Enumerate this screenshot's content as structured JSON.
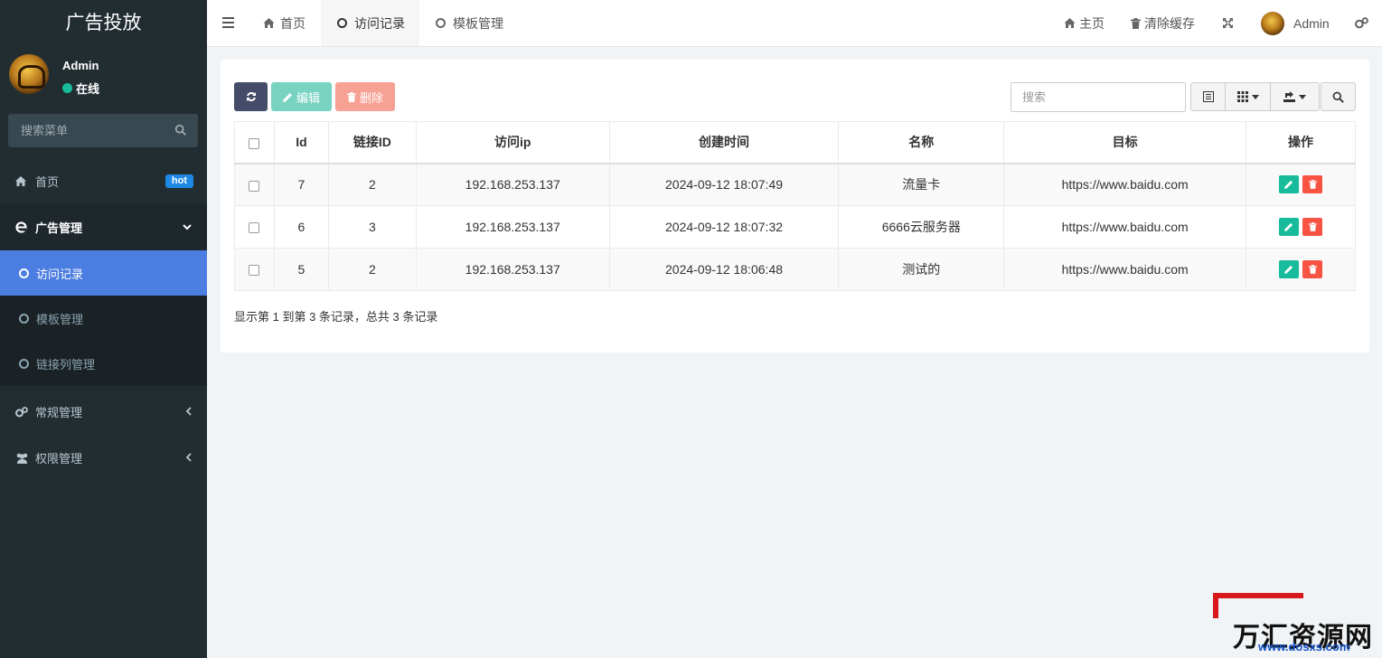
{
  "sidebar": {
    "title": "广告投放",
    "user": {
      "name": "Admin",
      "status": "在线"
    },
    "search_placeholder": "搜索菜单",
    "items": [
      {
        "label": "首页",
        "badge": "hot"
      },
      {
        "label": "广告管理"
      },
      {
        "label": "常规管理"
      },
      {
        "label": "权限管理"
      }
    ],
    "sub_items": [
      {
        "label": "访问记录"
      },
      {
        "label": "模板管理"
      },
      {
        "label": "链接列管理"
      }
    ]
  },
  "topbar": {
    "tabs": [
      {
        "label": "首页"
      },
      {
        "label": "访问记录"
      },
      {
        "label": "模板管理"
      }
    ],
    "right": {
      "home": "主页",
      "clear_cache": "清除缓存",
      "user": "Admin"
    }
  },
  "toolbar": {
    "edit_label": "编辑",
    "delete_label": "删除",
    "search_placeholder": "搜索"
  },
  "table": {
    "headers": [
      "Id",
      "链接ID",
      "访问ip",
      "创建时间",
      "名称",
      "目标",
      "操作"
    ],
    "rows": [
      {
        "id": "7",
        "link_id": "2",
        "ip": "192.168.253.137",
        "created": "2024-09-12 18:07:49",
        "name": "流量卡",
        "target": "https://www.baidu.com"
      },
      {
        "id": "6",
        "link_id": "3",
        "ip": "192.168.253.137",
        "created": "2024-09-12 18:07:32",
        "name": "6666云服务器",
        "target": "https://www.baidu.com"
      },
      {
        "id": "5",
        "link_id": "2",
        "ip": "192.168.253.137",
        "created": "2024-09-12 18:06:48",
        "name": "测试的",
        "target": "https://www.baidu.com"
      }
    ]
  },
  "pagination": {
    "summary": "显示第 1 到第 3 条记录，总共 3 条记录"
  },
  "watermark": {
    "text": "万汇资源网",
    "url": "www.dosxs.com"
  },
  "colors": {
    "sidebar_bg": "#222d32",
    "active_sub": "#4c7de0",
    "online": "#18bc9c",
    "edit": "#18bc9c",
    "delete": "#f75444",
    "refresh": "#444c69"
  }
}
